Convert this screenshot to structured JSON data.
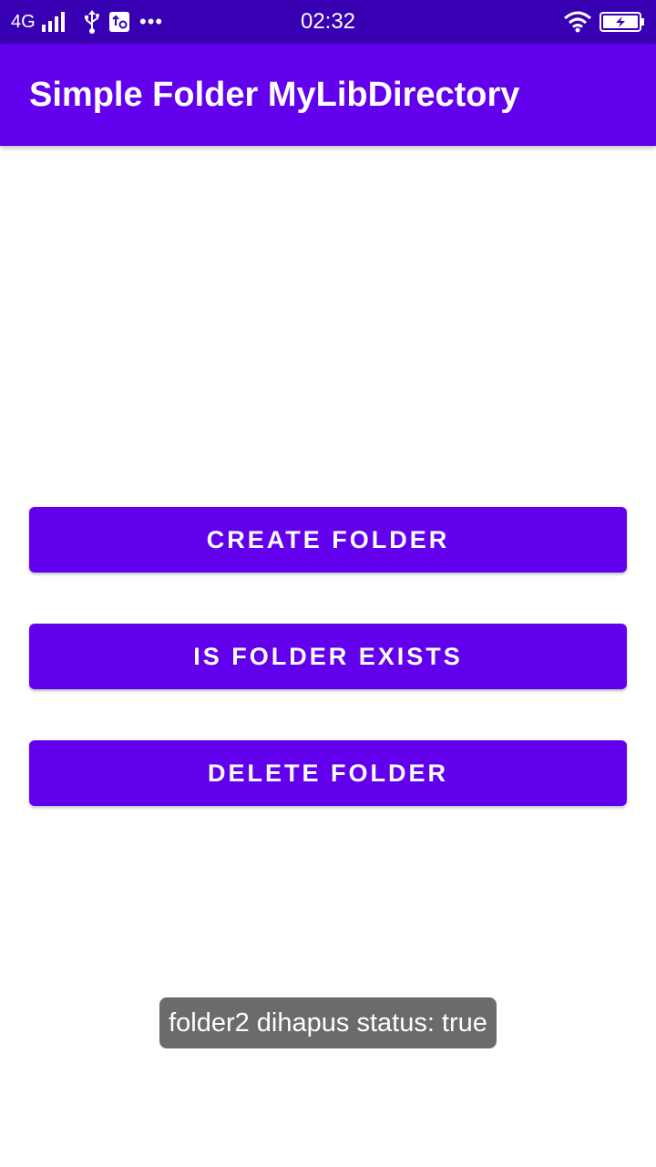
{
  "status_bar": {
    "network": "4G",
    "time": "02:32",
    "more": "•••",
    "icons": [
      "signal-icon",
      "usb-icon",
      "debug-icon",
      "wifi-icon",
      "battery-charging-icon"
    ]
  },
  "app_bar": {
    "title": "Simple Folder MyLibDirectory"
  },
  "buttons": {
    "create": "CREATE FOLDER",
    "exists": "IS FOLDER EXISTS",
    "delete": "DELETE FOLDER"
  },
  "toast": {
    "message": "folder2 dihapus status: true"
  },
  "colors": {
    "status_bar": "#3700b3",
    "primary": "#6200ee",
    "toast_bg": "#6b6b6b",
    "background": "#ffffff"
  }
}
